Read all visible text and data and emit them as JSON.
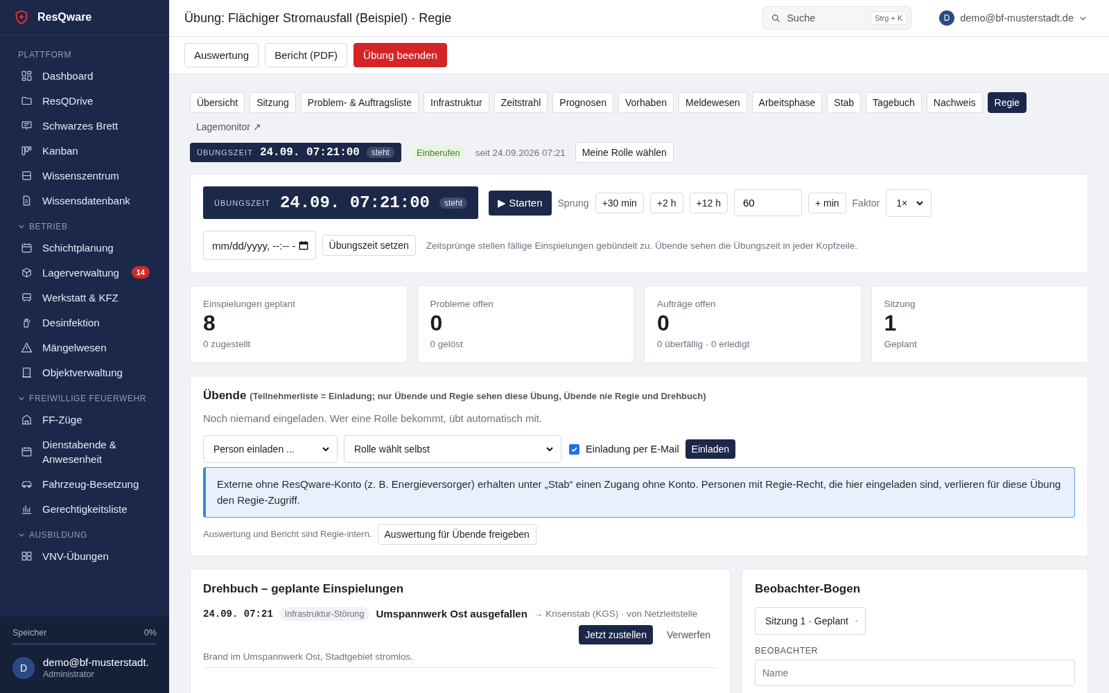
{
  "sidebar": {
    "brand": "ResQware",
    "sections": [
      {
        "title": "PLATTFORM",
        "items": [
          {
            "label": "Dashboard"
          },
          {
            "label": "ResQDrive"
          },
          {
            "label": "Schwarzes Brett"
          },
          {
            "label": "Kanban"
          },
          {
            "label": "Wissenszentrum"
          },
          {
            "label": "Wissensdatenbank"
          }
        ]
      },
      {
        "title": "BETRIEB",
        "expanded": true,
        "items": [
          {
            "label": "Schichtplanung"
          },
          {
            "label": "Lagerverwaltung",
            "badge": "14"
          },
          {
            "label": "Werkstatt & KFZ"
          },
          {
            "label": "Desinfektion"
          },
          {
            "label": "Mängelwesen"
          },
          {
            "label": "Objektverwaltung"
          }
        ]
      },
      {
        "title": "FREIWILLIGE FEUERWEHR",
        "expanded": true,
        "items": [
          {
            "label": "FF-Züge"
          },
          {
            "label": "Dienstabende & Anwesenheit"
          },
          {
            "label": "Fahrzeug-Besetzung"
          },
          {
            "label": "Gerechtigkeitsliste"
          }
        ]
      },
      {
        "title": "AUSBILDUNG",
        "expanded": true,
        "items": [
          {
            "label": "VNV-Übungen"
          }
        ]
      }
    ],
    "storage": {
      "label": "Speicher",
      "reading": "0%",
      "level": 0
    },
    "user": {
      "initial": "D",
      "name": "demo@bf-musterstadt.",
      "role": "Administrator"
    }
  },
  "header": {
    "title": "Übung: Flächiger Stromausfall (Beispiel) · Regie",
    "search": {
      "placeholder": "Suche",
      "shortcut": "Strg + K"
    },
    "account": {
      "initial": "D",
      "email": "demo@bf-musterstadt.de"
    }
  },
  "actions": [
    {
      "label": "Auswertung",
      "kind": "default"
    },
    {
      "label": "Bericht (PDF)",
      "kind": "default"
    },
    {
      "label": "Übung beenden",
      "kind": "danger"
    }
  ],
  "tabs": [
    {
      "label": "Übersicht",
      "selected": false
    },
    {
      "label": "Sitzung",
      "selected": false
    },
    {
      "label": "Problem- & Auftragsliste",
      "selected": false
    },
    {
      "label": "Infrastruktur",
      "selected": false
    },
    {
      "label": "Zeitstrahl",
      "selected": false
    },
    {
      "label": "Prognosen",
      "selected": false
    },
    {
      "label": "Vorhaben",
      "selected": false
    },
    {
      "label": "Meldewesen",
      "selected": false
    },
    {
      "label": "Arbeitsphase",
      "selected": false
    },
    {
      "label": "Stab",
      "selected": false
    },
    {
      "label": "Tagebuch",
      "selected": false
    },
    {
      "label": "Nachweis",
      "selected": false
    },
    {
      "label": "Regie",
      "selected": true
    }
  ],
  "monitor_link": "Lagemonitor ↗",
  "status_row": {
    "clock": {
      "label": "ÜBUNGSZEIT",
      "time": "24.09. 07:21:00",
      "state": "steht"
    },
    "phase": "Einberufen",
    "since": "seit 24.09.2026 07:21",
    "role_button": "Meine Rolle wählen"
  },
  "control": {
    "clock": {
      "label": "ÜBUNGSZEIT",
      "time": "24.09. 07:21:00",
      "state": "steht"
    },
    "start_button": "▶ Starten",
    "jump_label": "Sprung",
    "jumps": [
      "+30 min",
      "+2 h",
      "+12 h"
    ],
    "minutes": "60",
    "add_minutes": "+ min",
    "factor_label": "Faktor",
    "factor": "1×",
    "datetime_placeholder": "mm/dd/yyyy, --:-- -",
    "set_button": "Übungszeit setzen",
    "note": "Zeitsprünge stellen fällige Einspielungen gebündelt zu. Übende sehen die Übungszeit in jeder Kopfzeile."
  },
  "stats": [
    {
      "label": "Einspielungen geplant",
      "value": "8",
      "sub": "0 zugestellt"
    },
    {
      "label": "Probleme offen",
      "value": "0",
      "sub": "0 gelöst"
    },
    {
      "label": "Aufträge offen",
      "value": "0",
      "sub": "0 überfällig · 0 erledigt"
    },
    {
      "label": "Sitzung",
      "value": "1",
      "sub": "Geplant"
    }
  ],
  "participants": {
    "title": "Übende",
    "subtitle": "(Teilnehmerliste = Einladung; nur Übende und Regie sehen diese Übung, Übende nie Regie und Drehbuch)",
    "empty": "Noch niemand eingeladen. Wer eine Rolle bekommt, übt automatisch mit.",
    "person_select": "Person einladen ...",
    "role_select": "Rolle wählt selbst",
    "email_invite": {
      "label": "Einladung per E-Mail",
      "checked": true
    },
    "invite_button": "Einladen",
    "info": "Externe ohne ResQware-Konto (z. B. Energieversorger) erhalten unter „Stab“ einen Zugang ohne Konto. Personen mit Regie-Recht, die hier eingeladen sind, verlieren für diese Übung den Regie-Zugriff.",
    "footer": "Auswertung und Bericht sind Regie-intern.",
    "release_button": "Auswertung für Übende freigeben"
  },
  "script": {
    "title": "Drehbuch – geplante Einspielungen",
    "entries": [
      {
        "time": "24.09. 07:21",
        "tag": "Infrastruktur-Störung",
        "title": "Umspannwerk Ost ausgefallen",
        "route": "→ Krisenstab (KGS) · von Netzleitstelle",
        "deliver_button": "Jetzt zustellen",
        "discard_button": "Verwerfen",
        "description": "Brand im Umspannwerk Ost, Stadtgebiet stromlos."
      }
    ]
  },
  "observer": {
    "title": "Beobachter-Bogen",
    "session_select": "Sitzung 1 · Geplant",
    "field_label": "BEOBACHTER",
    "name_placeholder": "Name"
  }
}
